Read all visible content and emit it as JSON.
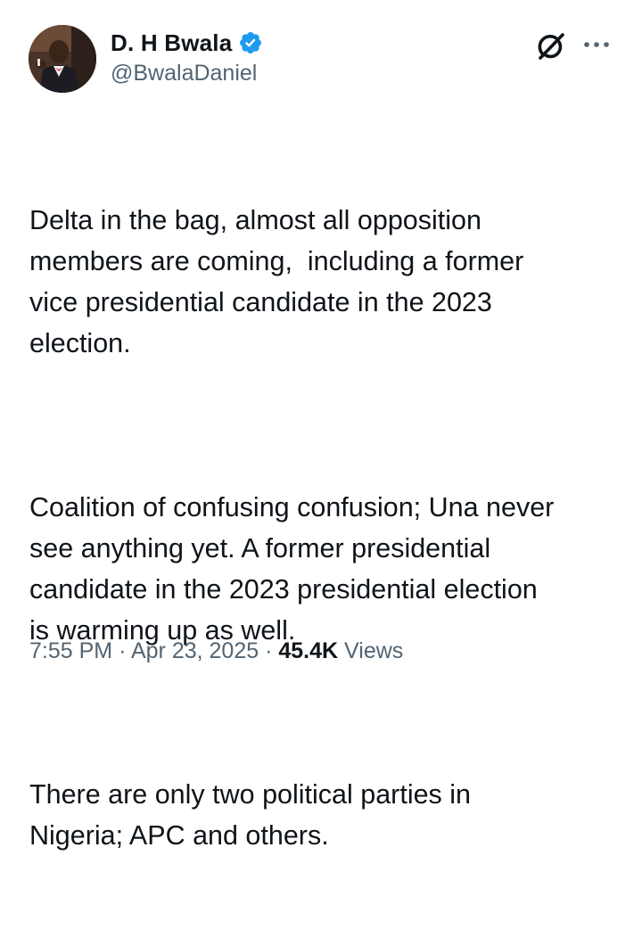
{
  "author": {
    "display_name": "D. H Bwala",
    "handle": "@BwalaDaniel",
    "verified_color": "#1d9bf0"
  },
  "actions": {
    "grok_icon": "grok-icon",
    "more_icon": "more-options-icon"
  },
  "tweet": {
    "paragraphs": [
      "Delta in the bag, almost all opposition\nmembers are coming,  including a former\nvice presidential candidate in the 2023\nelection.",
      "Coalition of confusing confusion; Una never\nsee anything yet. A former presidential\ncandidate in the 2023 presidential election\nis warming up as well.",
      "There are only two political parties in\nNigeria; APC and others."
    ]
  },
  "meta": {
    "time": "7:55 PM",
    "separator": "·",
    "date": "Apr 23, 2025",
    "views_count": "45.4K",
    "views_label": "Views"
  }
}
